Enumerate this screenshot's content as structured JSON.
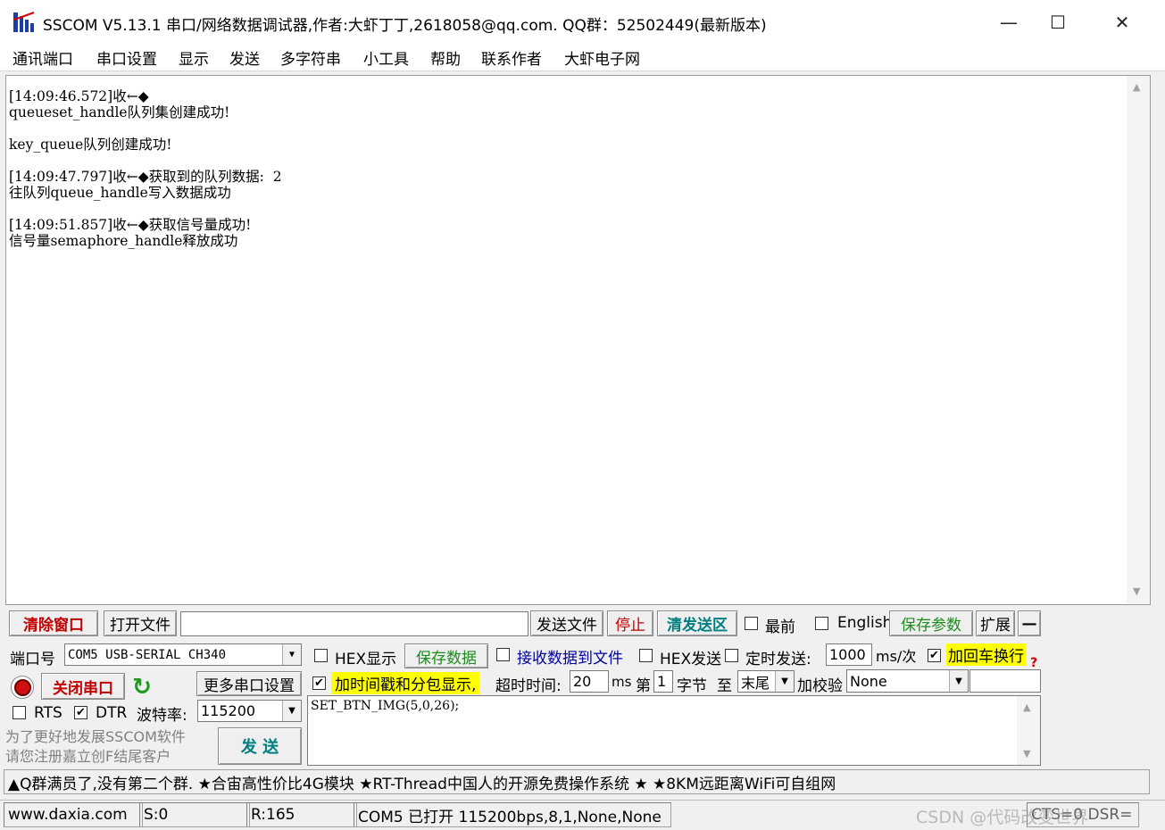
{
  "window": {
    "title": "SSCOM V5.13.1 串口/网络数据调试器,作者:大虾丁丁,2618058@qq.com. QQ群：52502449(最新版本)",
    "minimize": "—",
    "maximize": "☐",
    "close": "✕"
  },
  "menu": [
    "通讯端口",
    "串口设置",
    "显示",
    "发送",
    "多字符串",
    "小工具",
    "帮助",
    "联系作者",
    "大虾电子网"
  ],
  "receive": {
    "text": "[14:09:46.572]收←◆\nqueueset_handle队列集创建成功!\n\nkey_queue队列创建成功!\n\n[14:09:47.797]收←◆获取到的队列数据:  2\n往队列queue_handle写入数据成功\n\n[14:09:51.857]收←◆获取信号量成功!\n信号量semaphore_handle释放成功"
  },
  "toolbar": {
    "clear_window": "清除窗口",
    "open_file": "打开文件",
    "file_path": "",
    "send_file": "发送文件",
    "stop": "停止",
    "clear_send": "清发送区",
    "topmost_label": "最前",
    "english_label": "English",
    "save_params": "保存参数",
    "expand": "扩展",
    "collapse": "—"
  },
  "port": {
    "label": "端口号",
    "value": "COM5 USB-SERIAL CH340",
    "close_port": "关闭串口",
    "more_settings": "更多串口设置",
    "rts_label": "RTS",
    "dtr_label": "DTR",
    "rts_checked": false,
    "dtr_checked": true,
    "baud_label": "波特率:",
    "baud_value": "115200",
    "promo_line1": "为了更好地发展SSCOM软件",
    "promo_line2": "请您注册嘉立创F结尾客户"
  },
  "options": {
    "hex_display": "HEX显示",
    "save_data": "保存数据",
    "recv_to_file": "接收数据到文件",
    "hex_send": "HEX发送",
    "timed_send": "定时发送:",
    "interval": "1000",
    "interval_unit": "ms/次",
    "add_crlf": "加回车换行",
    "timestamp": "加时间戳和分包显示,",
    "timeout_label": "超时时间:",
    "timeout_value": "20",
    "timeout_unit": "ms",
    "byte_prefix": "第",
    "byte_value": "1",
    "byte_suffix": "字节",
    "to_label": "至",
    "end_value": "末尾",
    "checksum_label": "加校验",
    "checksum_value": "None",
    "help_mark": "?"
  },
  "send": {
    "text": "SET_BTN_IMG(5,0,26);",
    "send_button": "发  送"
  },
  "marquee": "▲Q群满员了,没有第二个群. ★合宙高性价比4G模块 ★RT-Thread中国人的开源免费操作系统 ★ ★8KM远距离WiFi可自组网",
  "status": {
    "website": "www.daxia.com",
    "sent": "S:0",
    "received": "R:165",
    "port_state": "COM5 已打开  115200bps,8,1,None,None",
    "signals": "CTS=0 DSR=",
    "watermark": "CSDN @代码改变世界"
  },
  "colors": {
    "red_text": "#c00000",
    "teal_text": "#007f80",
    "green_text": "#1e8b1e",
    "highlight": "#ffff00"
  }
}
